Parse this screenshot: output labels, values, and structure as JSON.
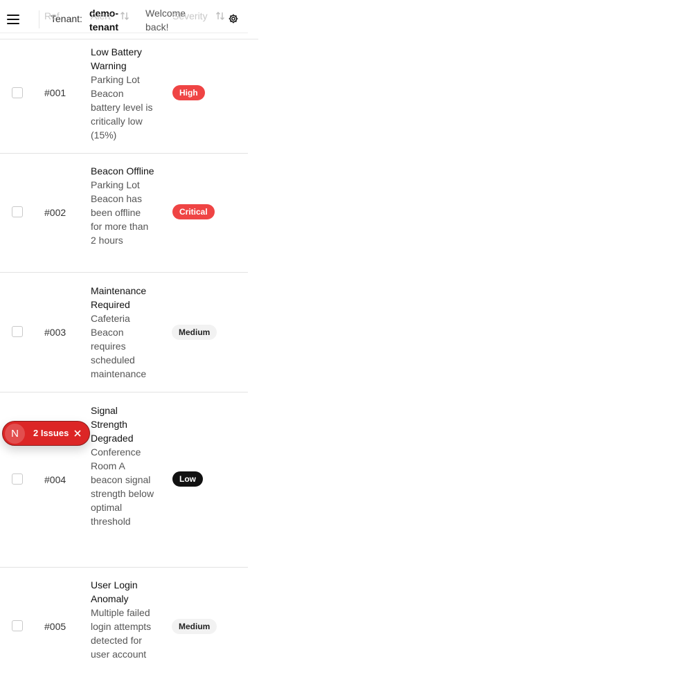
{
  "header": {
    "tenant_label": "Tenant:",
    "tenant_value": "demo-tenant",
    "welcome": "Welcome back!",
    "menu_icon": "hamburger-menu-icon",
    "settings_icon": "gear-icon"
  },
  "columns": {
    "ref": "Ref",
    "alert": "Alert",
    "severity": "Severity"
  },
  "rows": [
    {
      "ref": "#001",
      "title": "Low Battery Warning",
      "description": "Parking Lot Beacon battery level is critically low (15%)",
      "severity": "High"
    },
    {
      "ref": "#002",
      "title": "Beacon Offline",
      "description": "Parking Lot Beacon has been offline for more than 2 hours",
      "severity": "Critical"
    },
    {
      "ref": "#003",
      "title": "Maintenance Required",
      "description": "Cafeteria Beacon requires scheduled maintenance",
      "severity": "Medium"
    },
    {
      "ref": "#004",
      "title": "Signal Strength Degraded",
      "description": "Conference Room A beacon signal strength below optimal threshold",
      "severity": "Low"
    },
    {
      "ref": "#005",
      "title": "User Login Anomaly",
      "description": "Multiple failed login attempts detected for user account",
      "severity": "Medium"
    }
  ],
  "toast": {
    "avatar_letter": "N",
    "text": "2 Issues"
  },
  "colors": {
    "high": "#ef4444",
    "critical": "#ef4444",
    "medium": "#f2f2f2",
    "low": "#111111",
    "toast": "#dc2626"
  }
}
